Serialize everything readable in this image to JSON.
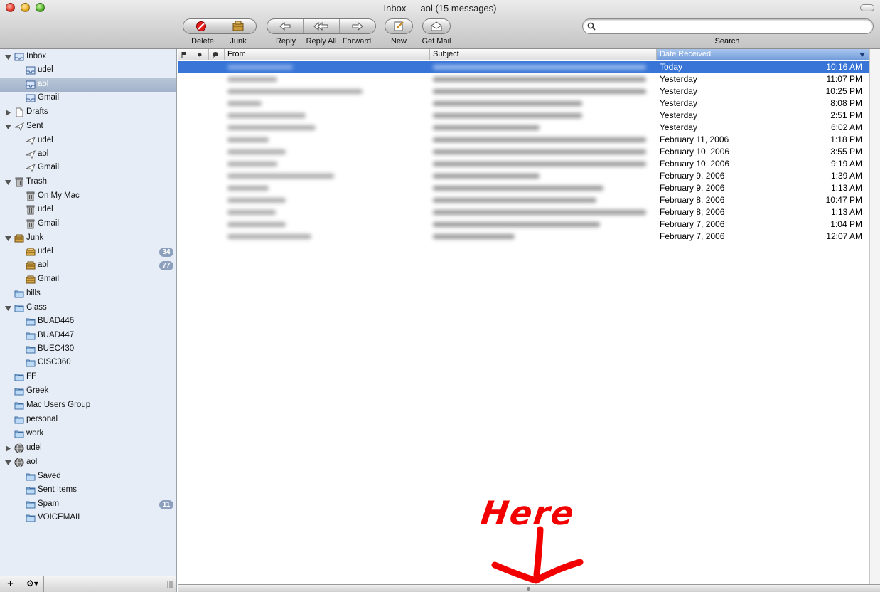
{
  "window": {
    "title": "Inbox — aol (15 messages)"
  },
  "toolbar": {
    "delete_label": "Delete",
    "junk_label": "Junk",
    "reply_label": "Reply",
    "reply_all_label": "Reply All",
    "forward_label": "Forward",
    "new_label": "New",
    "get_mail_label": "Get Mail",
    "search_label": "Search",
    "search_value": ""
  },
  "sidebar": {
    "items": [
      {
        "label": "Inbox",
        "depth": 0,
        "expanded": true,
        "icon": "inbox-icon"
      },
      {
        "label": "udel",
        "depth": 1,
        "icon": "inbox-icon"
      },
      {
        "label": "aol",
        "depth": 1,
        "icon": "inbox-icon",
        "selected": true
      },
      {
        "label": "Gmail",
        "depth": 1,
        "icon": "inbox-icon"
      },
      {
        "label": "Drafts",
        "depth": 0,
        "expanded": false,
        "icon": "document-icon"
      },
      {
        "label": "Sent",
        "depth": 0,
        "expanded": true,
        "icon": "paper-plane-icon"
      },
      {
        "label": "udel",
        "depth": 1,
        "icon": "paper-plane-icon"
      },
      {
        "label": "aol",
        "depth": 1,
        "icon": "paper-plane-icon"
      },
      {
        "label": "Gmail",
        "depth": 1,
        "icon": "paper-plane-icon"
      },
      {
        "label": "Trash",
        "depth": 0,
        "expanded": true,
        "icon": "trash-icon"
      },
      {
        "label": "On My Mac",
        "depth": 1,
        "icon": "trash-icon"
      },
      {
        "label": "udel",
        "depth": 1,
        "icon": "trash-icon"
      },
      {
        "label": "Gmail",
        "depth": 1,
        "icon": "trash-icon"
      },
      {
        "label": "Junk",
        "depth": 0,
        "expanded": true,
        "icon": "junk-icon"
      },
      {
        "label": "udel",
        "depth": 1,
        "icon": "junk-icon",
        "badge": "34"
      },
      {
        "label": "aol",
        "depth": 1,
        "icon": "junk-icon",
        "badge": "77"
      },
      {
        "label": "Gmail",
        "depth": 1,
        "icon": "junk-icon"
      },
      {
        "label": "bills",
        "depth": 0,
        "icon": "folder-icon"
      },
      {
        "label": "Class",
        "depth": 0,
        "expanded": true,
        "icon": "folder-icon"
      },
      {
        "label": "BUAD446",
        "depth": 1,
        "icon": "folder-icon"
      },
      {
        "label": "BUAD447",
        "depth": 1,
        "icon": "folder-icon"
      },
      {
        "label": "BUEC430",
        "depth": 1,
        "icon": "folder-icon"
      },
      {
        "label": "CISC360",
        "depth": 1,
        "icon": "folder-icon"
      },
      {
        "label": "FF",
        "depth": 0,
        "icon": "folder-icon"
      },
      {
        "label": "Greek",
        "depth": 0,
        "icon": "folder-icon"
      },
      {
        "label": "Mac Users Group",
        "depth": 0,
        "icon": "folder-icon"
      },
      {
        "label": "personal",
        "depth": 0,
        "icon": "folder-icon"
      },
      {
        "label": "work",
        "depth": 0,
        "icon": "folder-icon"
      },
      {
        "label": "udel",
        "depth": 0,
        "expanded": false,
        "icon": "globe-icon"
      },
      {
        "label": "aol",
        "depth": 0,
        "expanded": true,
        "icon": "globe-icon"
      },
      {
        "label": "Saved",
        "depth": 1,
        "icon": "folder-icon"
      },
      {
        "label": "Sent Items",
        "depth": 1,
        "icon": "folder-icon"
      },
      {
        "label": "Spam",
        "depth": 1,
        "icon": "folder-icon",
        "badge": "11"
      },
      {
        "label": "VOICEMAIL",
        "depth": 1,
        "icon": "folder-icon"
      }
    ]
  },
  "list": {
    "columns": {
      "flag": "flag-icon",
      "status": "unread-dot-icon",
      "chat": "speech-bubble-icon",
      "from": "From",
      "subject": "Subject",
      "date": "Date Received"
    },
    "messages": [
      {
        "date": "Today",
        "time": "10:16 AM",
        "selected": true
      },
      {
        "date": "Yesterday",
        "time": "11:07 PM"
      },
      {
        "date": "Yesterday",
        "time": "10:25 PM"
      },
      {
        "date": "Yesterday",
        "time": "8:08 PM"
      },
      {
        "date": "Yesterday",
        "time": "2:51 PM"
      },
      {
        "date": "Yesterday",
        "time": "6:02 AM"
      },
      {
        "date": "February 11, 2006",
        "time": "1:18 PM"
      },
      {
        "date": "February 10, 2006",
        "time": "3:55 PM"
      },
      {
        "date": "February 10, 2006",
        "time": "9:19 AM"
      },
      {
        "date": "February 9, 2006",
        "time": "1:39 AM"
      },
      {
        "date": "February 9, 2006",
        "time": "1:13 AM"
      },
      {
        "date": "February 8, 2006",
        "time": "10:47 PM"
      },
      {
        "date": "February 8, 2006",
        "time": "1:13 AM"
      },
      {
        "date": "February 7, 2006",
        "time": "1:04 PM"
      },
      {
        "date": "February 7, 2006",
        "time": "12:07 AM"
      }
    ]
  },
  "sidebar_bottom": {
    "add_label": "+",
    "action_label": "⚙▾"
  },
  "annotation": {
    "text": "Here",
    "color": "#f20000"
  },
  "colors": {
    "selection": "#3875d7",
    "sidebar_bg": "#e6edf6",
    "sorted_header": "#6f9ad8"
  }
}
